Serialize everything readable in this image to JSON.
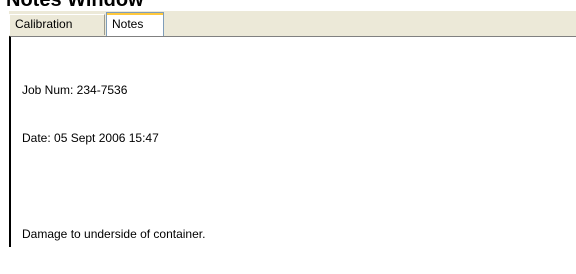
{
  "window": {
    "heading": "Notes Window"
  },
  "tabs": [
    {
      "label": "Calibration",
      "selected": false
    },
    {
      "label": "Notes",
      "selected": true
    }
  ],
  "notes": {
    "job_line": "Job Num: 234-7536",
    "date_line": "Date: 05 Sept 2006 15:47",
    "comment_line": "Damage to underside of container."
  },
  "colors": {
    "tab_face": "#ece9d8",
    "selected_tab_accent": "#ffc83c",
    "panel_background": "#ffffff"
  }
}
